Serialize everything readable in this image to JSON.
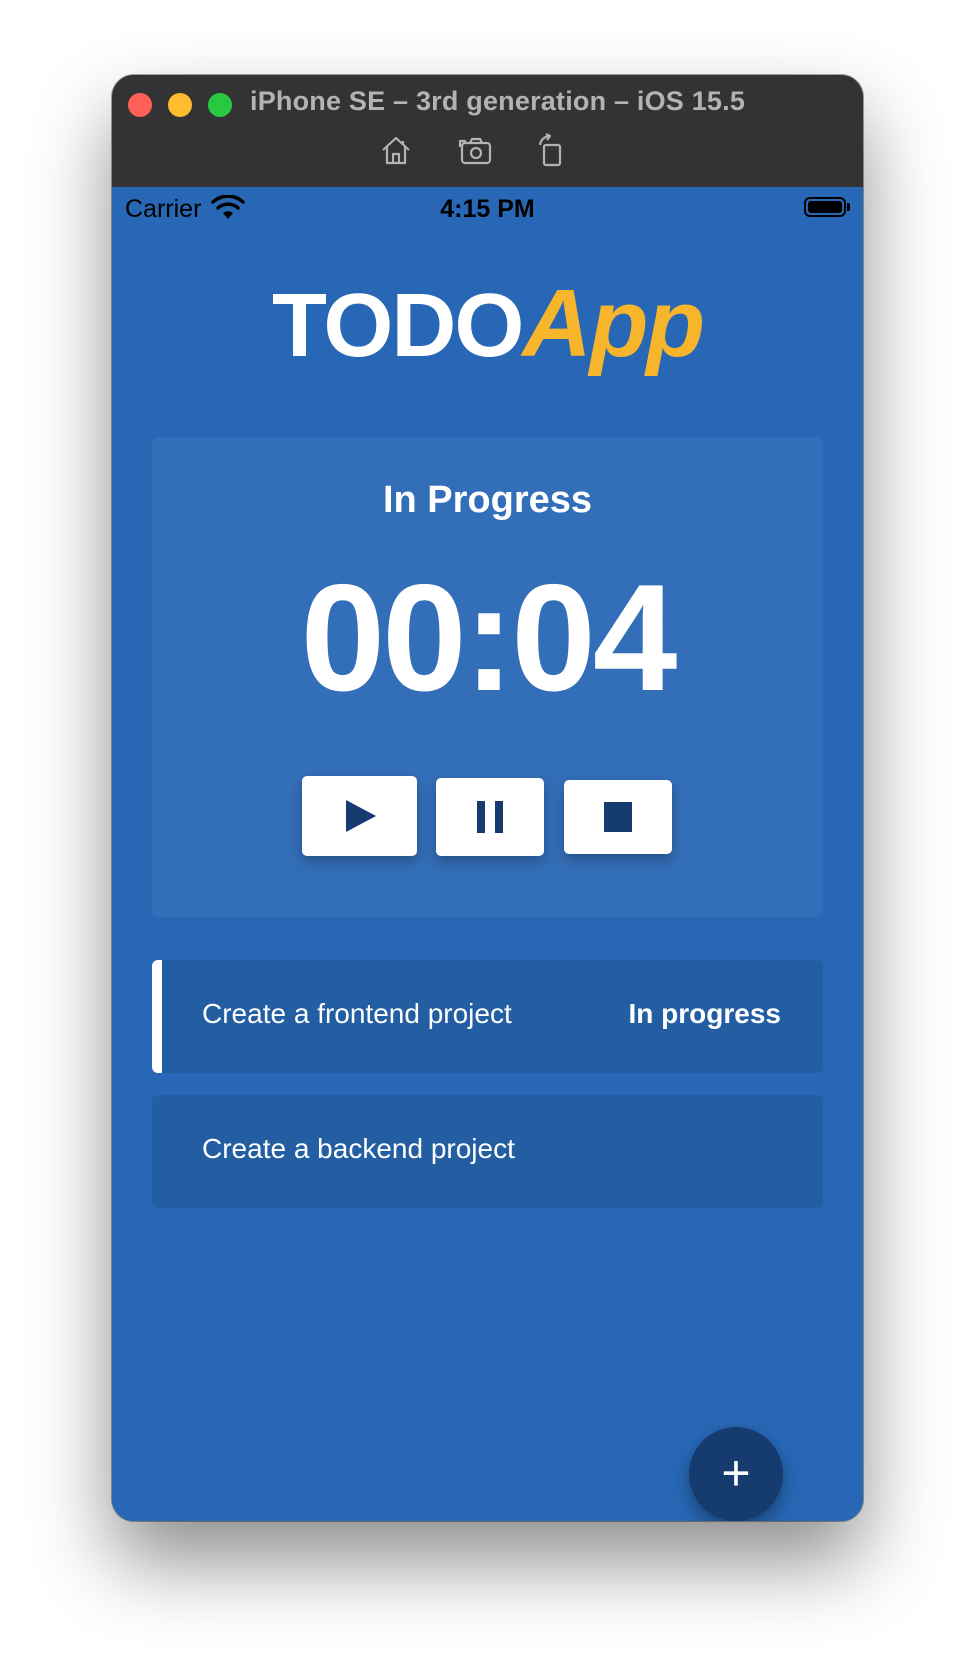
{
  "window": {
    "title": "iPhone SE – 3rd generation – iOS 15.5",
    "toolbar_icons": [
      "home-icon",
      "screenshot-icon",
      "rotate-icon"
    ]
  },
  "status_bar": {
    "carrier": "Carrier",
    "time": "4:15 PM"
  },
  "logo": {
    "part1": "TODO",
    "part2": "App"
  },
  "timer": {
    "title": "In Progress",
    "display": "00:04",
    "controls": [
      "play-icon",
      "pause-icon",
      "stop-icon"
    ]
  },
  "tasks": [
    {
      "name": "Create a frontend project",
      "status": "In progress"
    },
    {
      "name": "Create a backend project",
      "status": ""
    }
  ],
  "fab": {
    "label": "+"
  },
  "colors": {
    "background": "#2767b5",
    "card": "#336eb8",
    "task": "#235ea3",
    "accent": "#f6b52a",
    "dark": "#153b6f"
  }
}
